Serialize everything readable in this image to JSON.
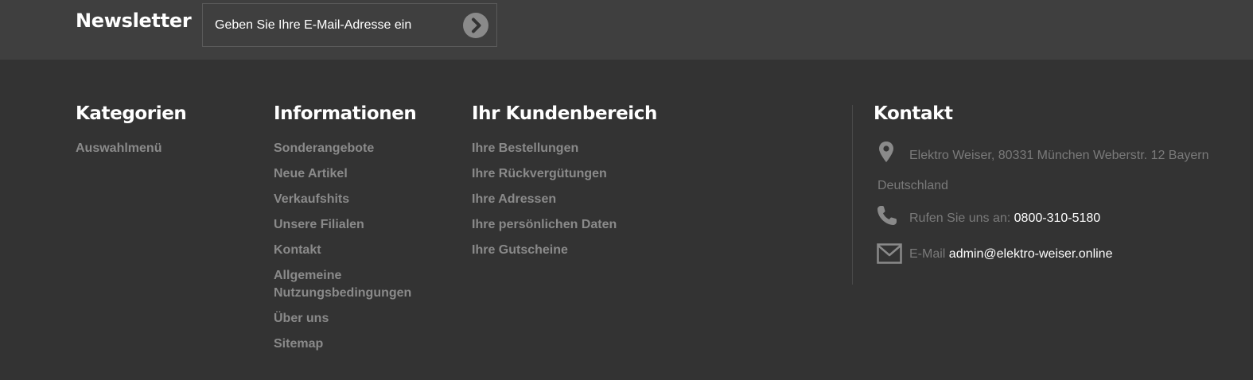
{
  "newsletter": {
    "title": "Newsletter",
    "placeholder": "Geben Sie Ihre E-Mail-Adresse ein",
    "submit_icon": "chevron-right-circle-icon"
  },
  "columns": {
    "kategorien": {
      "title": "Kategorien",
      "items": [
        "Auswahlmenü"
      ]
    },
    "informationen": {
      "title": "Informationen",
      "items": [
        "Sonderangebote",
        "Neue Artikel",
        "Verkaufshits",
        "Unsere Filialen",
        "Kontakt",
        "Allgemeine Nutzungsbedingungen",
        "Über uns",
        "Sitemap"
      ]
    },
    "kundenbereich": {
      "title": "Ihr Kundenbereich",
      "items": [
        "Ihre Bestellungen",
        "Ihre Rückvergütungen",
        "Ihre Adressen",
        "Ihre persönlichen Daten",
        "Ihre Gutscheine"
      ]
    }
  },
  "contact": {
    "title": "Kontakt",
    "address": "Elektro Weiser, 80331 München Weberstr. 12 Bayern Deutschland",
    "phone_label": "Rufen Sie uns an:",
    "phone": "0800-310-5180",
    "email_label": "E-Mail",
    "email": "admin@elektro-weiser.online",
    "icons": [
      "map-marker-icon",
      "phone-icon",
      "envelope-icon"
    ]
  },
  "colors": {
    "background": "#333333",
    "newsletter_bar": "#3f3f3f",
    "link": "#8a8a8a",
    "heading": "#ffffff"
  }
}
